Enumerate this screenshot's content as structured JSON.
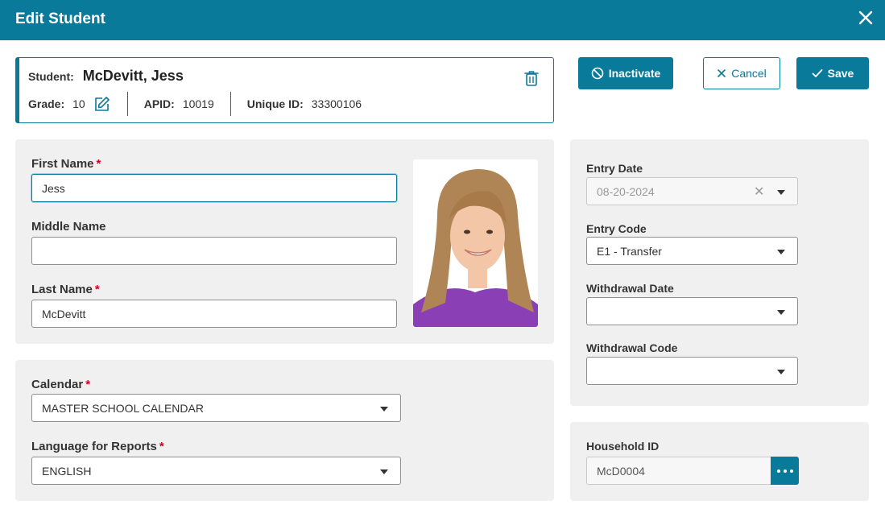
{
  "dialog": {
    "title": "Edit Student"
  },
  "student": {
    "student_label": "Student:",
    "name": "McDevitt, Jess",
    "grade_label": "Grade:",
    "grade": "10",
    "apid_label": "APID:",
    "apid": "10019",
    "unique_id_label": "Unique ID:",
    "unique_id": "33300106"
  },
  "actions": {
    "inactivate": "Inactivate",
    "cancel": "Cancel",
    "save": "Save"
  },
  "names": {
    "first_name_label": "First Name",
    "first_name_value": "Jess",
    "middle_name_label": "Middle Name",
    "middle_name_value": "",
    "last_name_label": "Last Name",
    "last_name_value": "McDevitt",
    "required_mark": "*"
  },
  "calendar": {
    "calendar_label": "Calendar",
    "calendar_value": "MASTER SCHOOL CALENDAR",
    "language_label": "Language for Reports",
    "language_value": "ENGLISH"
  },
  "enrollment": {
    "entry_date_label": "Entry Date",
    "entry_date_value": "08-20-2024",
    "entry_code_label": "Entry Code",
    "entry_code_value": "E1 - Transfer",
    "withdrawal_date_label": "Withdrawal Date",
    "withdrawal_date_value": "",
    "withdrawal_code_label": "Withdrawal Code",
    "withdrawal_code_value": ""
  },
  "household": {
    "label": "Household ID",
    "value": "McD0004"
  },
  "colors": {
    "primary": "#0a7a9b",
    "required": "#d0021b",
    "panel_bg": "#f0f0f0"
  }
}
